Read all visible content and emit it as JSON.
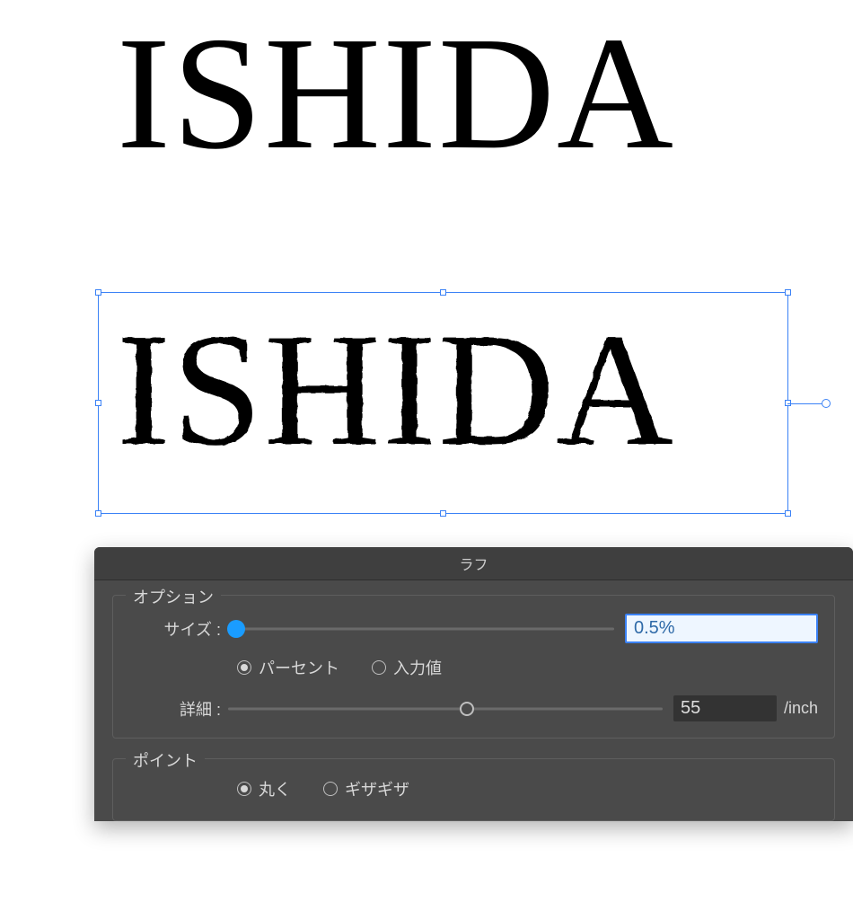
{
  "canvas": {
    "text_top": "ISHIDA",
    "text_bottom": "ISHIDA"
  },
  "panel": {
    "title": "ラフ",
    "options": {
      "legend": "オプション",
      "size_label": "サイズ :",
      "size_value": "0.5%",
      "size_percent": 0.5,
      "unit_percent_label": "パーセント",
      "unit_absolute_label": "入力値",
      "unit_selected": "percent",
      "detail_label": "詳細 :",
      "detail_value": "55",
      "detail_unit": "/inch"
    },
    "points": {
      "legend": "ポイント",
      "smooth_label": "丸く",
      "corner_label": "ギザギザ",
      "selected": "smooth"
    }
  }
}
